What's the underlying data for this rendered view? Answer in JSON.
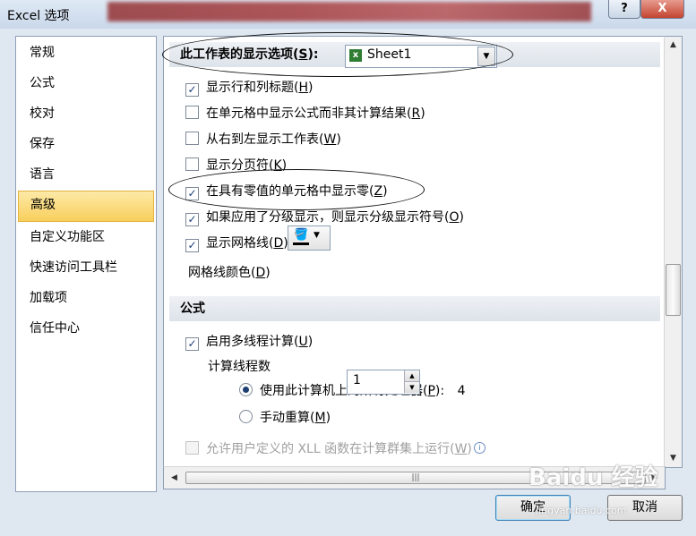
{
  "window": {
    "title": "Excel 选项",
    "help_label": "?",
    "close_label": "X"
  },
  "nav": {
    "items": [
      {
        "label": "常规"
      },
      {
        "label": "公式"
      },
      {
        "label": "校对"
      },
      {
        "label": "保存"
      },
      {
        "label": "语言"
      },
      {
        "label": "高级"
      },
      {
        "label": "自定义功能区"
      },
      {
        "label": "快速访问工具栏"
      },
      {
        "label": "加载项"
      },
      {
        "label": "信任中心"
      }
    ],
    "active": "高级"
  },
  "worksheet_section": {
    "label_prefix": "此工作表的显示选项(",
    "label_key": "S",
    "label_suffix": "):",
    "selected_sheet": "Sheet1"
  },
  "worksheet_options": [
    {
      "pre": "显示行和列标题(",
      "key": "H",
      "post": ")",
      "checked": true
    },
    {
      "pre": "在单元格中显示公式而非其计算结果(",
      "key": "R",
      "post": ")",
      "checked": false
    },
    {
      "pre": "从右到左显示工作表(",
      "key": "W",
      "post": ")",
      "checked": false
    },
    {
      "pre": "显示分页符(",
      "key": "K",
      "post": ")",
      "checked": false
    },
    {
      "pre": "在具有零值的单元格中显示零(",
      "key": "Z",
      "post": ")",
      "checked": true
    },
    {
      "pre": "如果应用了分级显示，则显示分级显示符号(",
      "key": "O",
      "post": ")",
      "checked": true
    },
    {
      "pre": "显示网格线(",
      "key": "D",
      "post": ")",
      "checked": true
    }
  ],
  "gridline_color": {
    "pre": "网格线颜色(",
    "key": "D",
    "post": ")",
    "color": "#000000"
  },
  "formulas_section": {
    "title": "公式"
  },
  "formulas": {
    "multithread": {
      "pre": "启用多线程计算(",
      "key": "U",
      "post": ")",
      "checked": true
    },
    "threads_label": "计算线程数",
    "all_processors": {
      "pre": "使用此计算机上的所有处理器(",
      "key": "P",
      "post": "):",
      "count": "4",
      "selected": true
    },
    "manual": {
      "pre": "手动重算(",
      "key": "M",
      "post": ")",
      "value": "1",
      "selected": false
    },
    "xll": {
      "pre": "允许用户定义的 XLL 函数在计算群集上运行(",
      "key": "W",
      "post": ")",
      "checked": false,
      "enabled": false
    },
    "info_glyph": "i"
  },
  "footer": {
    "ok_label": "确定",
    "cancel_label": "取消"
  },
  "watermark": {
    "text": "Baidu 经验",
    "sub": "jingyan.baidu.com"
  },
  "colors": {
    "accent_active_nav": "#f8cf5c",
    "title_bar": "#c9d8ea",
    "close_button": "#c44330"
  }
}
